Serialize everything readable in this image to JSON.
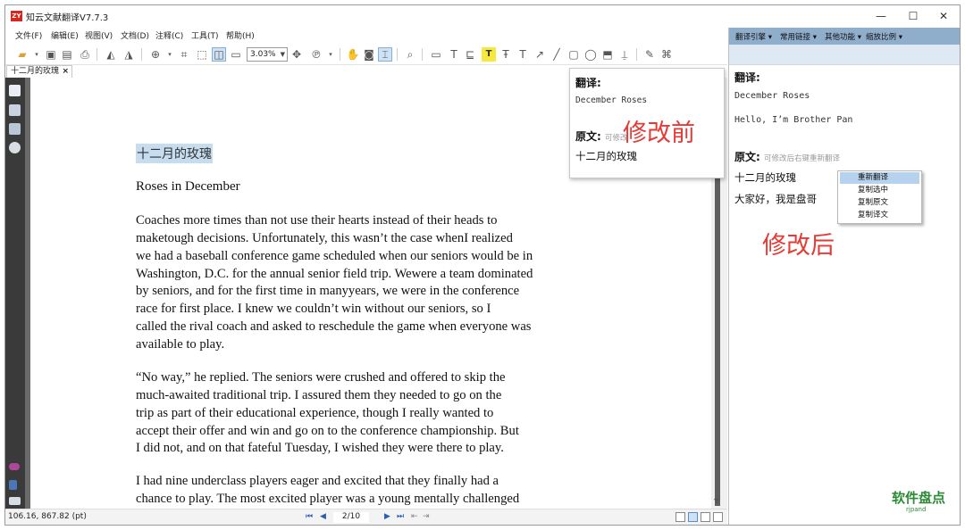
{
  "window": {
    "title": "知云文献翻译V7.7.3",
    "app_icon_text": "ZY",
    "controls": {
      "minimize": "—",
      "maximize": "☐",
      "close": "✕"
    }
  },
  "menu": [
    {
      "label": "文件(F)"
    },
    {
      "label": "编辑(E)"
    },
    {
      "label": "视图(V)"
    },
    {
      "label": "文档(D)"
    },
    {
      "label": "注释(C)"
    },
    {
      "label": "工具(T)"
    },
    {
      "label": "帮助(H)"
    }
  ],
  "toolbar": {
    "zoom_value": "3.03%",
    "icons": [
      "open-folder-icon",
      "save-icon",
      "save-as-icon",
      "print-icon",
      "rotate-left-icon",
      "rotate-right-icon",
      "zoom-in-icon",
      "crop-icon",
      "fit-page-icon",
      "fit-width-icon",
      "hand-icon",
      "snapshot-icon",
      "select-text-icon",
      "find-icon",
      "note-icon",
      "text-box-icon",
      "highlight-icon",
      "strikeout-icon",
      "underline-icon",
      "arrow-icon",
      "line-icon",
      "rectangle-icon",
      "ellipse-icon",
      "stamp-icon",
      "edit-icon"
    ]
  },
  "tab": {
    "label": "十二月的玫瑰",
    "close": "×"
  },
  "document": {
    "title_cn": "十二月的玫瑰",
    "heading": "Roses in December",
    "paragraphs": [
      [
        "Coaches more times than not use their hearts instead of their heads to",
        "maketough decisions.   Unfortunately,   this  wasn’t   the case  whenI realized",
        "we had a baseball    conference game   scheduled when our seniors would        be in",
        "Washington,  D.C. for  the  annual  senior  field  trip.   Wewere a team dominated",
        "by seniors,   and for  the  first   time  in  manyyears,   we were  in  the  conference",
        "race for first place. I knew we couldn’t win without our seniors, so I",
        "called   the  rival   coach  and  asked  to  reschedule   the  game when everyone  was",
        "available to play."
      ],
      [
        "“No way,” he replied.         The seniors were     crushed  and offered to     skip the",
        "much-awaited traditional trip. I assured them they needed to go on the",
        "trip as part of their educational experience, though I really wanted to",
        "accept their offer and          win and go   on to the     conference championship. But",
        "I  did  not,   and  on that   fateful    Tuesday,  I  wished  they   were there   to  play."
      ],
      [
        "I had nine underclass players eager and excited that they finally had a",
        "chance to play. The most excited player was a young mentally challenged"
      ]
    ]
  },
  "popup_before": {
    "translation_label": "翻译:",
    "translation": "December Roses",
    "source_label": "原文:",
    "source_hint": "可修改",
    "source": "十二月的玫瑰"
  },
  "annotations": {
    "before": "修改前",
    "after": "修改后"
  },
  "status": {
    "coords": "106.16, 867.82 (pt)",
    "page": "2/10"
  },
  "right_panel": {
    "toolbar": [
      "翻译引擎 ▾",
      "常用链接 ▾",
      "其他功能 ▾",
      "缩放比例 ▾"
    ],
    "translation_label": "翻译:",
    "translation_lines": [
      "December Roses",
      "Hello, I’m Brother Pan"
    ],
    "source_label": "原文:",
    "source_hint": "可修改后右键重新翻译",
    "source_lines": [
      "十二月的玫瑰",
      "大家好，我是盘哥"
    ],
    "context_menu": [
      "重新翻译",
      "复制选中",
      "复制原文",
      "复制译文"
    ]
  },
  "watermark": {
    "text": "软件盘点",
    "sub": "rjpand"
  },
  "colors": {
    "accent": "#e53a35",
    "panel_toolbar": "#8eaecb",
    "selection": "#c6dcef",
    "watermark": "#2c8a36"
  }
}
